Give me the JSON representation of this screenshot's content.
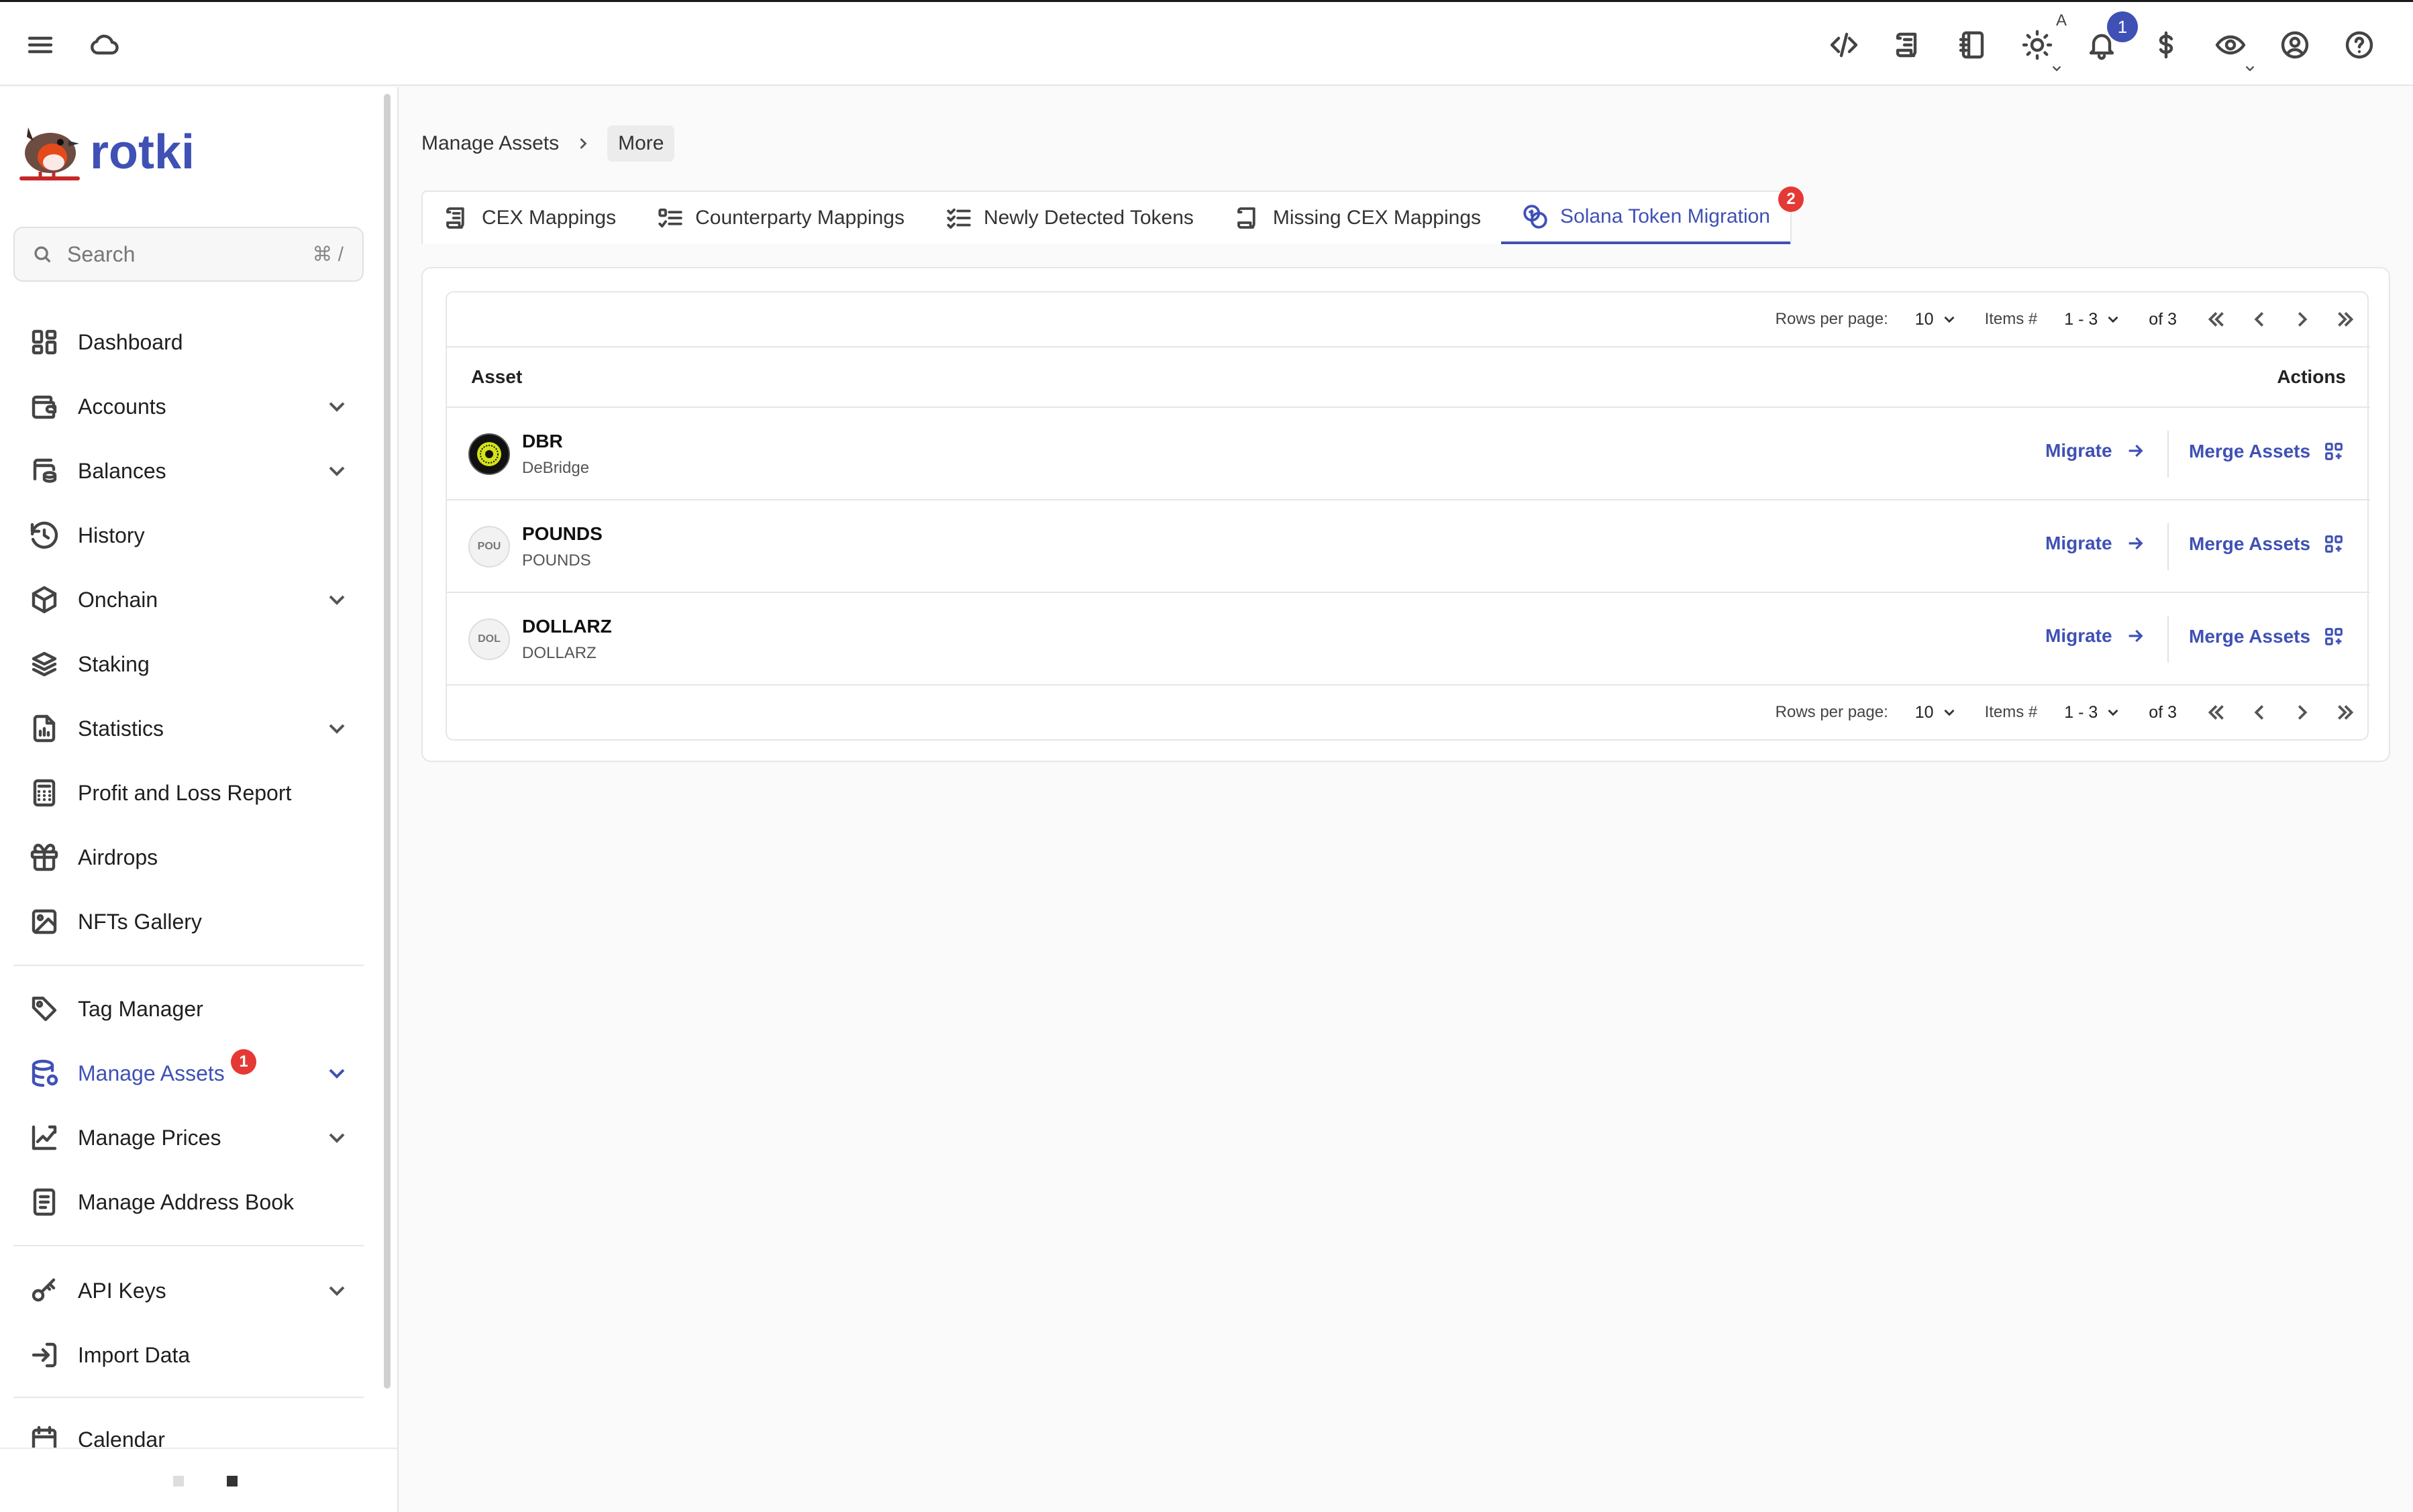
{
  "app": {
    "name": "rotki"
  },
  "topbar": {
    "notifications_count": "1",
    "theme_mode_letter": "A"
  },
  "sidebar": {
    "search": {
      "placeholder": "Search",
      "shortcut": "⌘ /"
    },
    "items": [
      {
        "label": "Dashboard",
        "icon": "dashboard-icon",
        "has_children": false
      },
      {
        "label": "Accounts",
        "icon": "wallet-icon",
        "has_children": true
      },
      {
        "label": "Balances",
        "icon": "balances-icon",
        "has_children": true
      },
      {
        "label": "History",
        "icon": "history-icon",
        "has_children": false
      },
      {
        "label": "Onchain",
        "icon": "cube-icon",
        "has_children": true
      },
      {
        "label": "Staking",
        "icon": "stack-icon",
        "has_children": false
      },
      {
        "label": "Statistics",
        "icon": "statistics-icon",
        "has_children": true
      },
      {
        "label": "Profit and Loss Report",
        "icon": "calculator-icon",
        "has_children": false
      },
      {
        "label": "Airdrops",
        "icon": "gift-icon",
        "has_children": false
      },
      {
        "label": "NFTs Gallery",
        "icon": "image-icon",
        "has_children": false
      },
      {
        "label": "Tag Manager",
        "icon": "tag-icon",
        "has_children": false
      },
      {
        "label": "Manage Assets",
        "icon": "database-icon",
        "has_children": true,
        "active": true,
        "badge": "1"
      },
      {
        "label": "Manage Prices",
        "icon": "price-chart-icon",
        "has_children": true
      },
      {
        "label": "Manage Address Book",
        "icon": "address-book-icon",
        "has_children": false
      },
      {
        "label": "API Keys",
        "icon": "key-icon",
        "has_children": true
      },
      {
        "label": "Import Data",
        "icon": "import-icon",
        "has_children": false
      },
      {
        "label": "Calendar",
        "icon": "calendar-icon",
        "has_children": false
      }
    ]
  },
  "breadcrumb": {
    "parent": "Manage Assets",
    "current": "More"
  },
  "tabs": [
    {
      "label": "CEX Mappings",
      "icon": "scroll-icon"
    },
    {
      "label": "Counterparty Mappings",
      "icon": "checklist-icon"
    },
    {
      "label": "Newly Detected Tokens",
      "icon": "list-check-icon"
    },
    {
      "label": "Missing CEX Mappings",
      "icon": "scroll-icon"
    },
    {
      "label": "Solana Token Migration",
      "icon": "coins-icon",
      "active": true,
      "badge": "2"
    }
  ],
  "pagination": {
    "rows_per_page_label": "Rows per page:",
    "rows_per_page": "10",
    "items_label": "Items #",
    "range": "1 - 3",
    "of_total": "of 3"
  },
  "table": {
    "headers": {
      "asset": "Asset",
      "actions": "Actions"
    },
    "rows": [
      {
        "symbol": "DBR",
        "name": "DeBridge",
        "avatar_text": ""
      },
      {
        "symbol": "POUNDS",
        "name": "POUNDS",
        "avatar_text": "POU"
      },
      {
        "symbol": "DOLLARZ",
        "name": "DOLLARZ",
        "avatar_text": "DOL"
      }
    ],
    "actions": {
      "migrate": "Migrate",
      "merge": "Merge Assets"
    }
  },
  "colors": {
    "accent": "#3f51b5",
    "badge": "#e53935"
  }
}
